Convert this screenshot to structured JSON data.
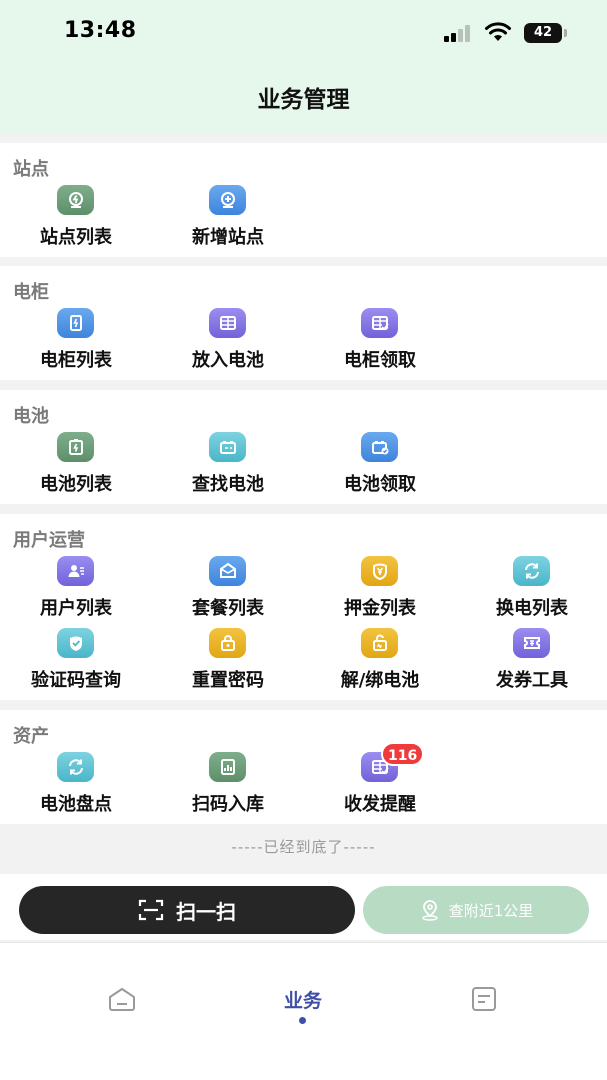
{
  "status_bar": {
    "time": "13:48",
    "battery": "42"
  },
  "header": {
    "title": "业务管理"
  },
  "sections": [
    {
      "title": "站点",
      "items": [
        {
          "label": "站点列表",
          "icon": "station-list-icon",
          "color": "#6b9c78"
        },
        {
          "label": "新增站点",
          "icon": "add-station-icon",
          "color": "#4a8fe3"
        }
      ]
    },
    {
      "title": "电柜",
      "items": [
        {
          "label": "电柜列表",
          "icon": "cabinet-list-icon",
          "color": "#4a8fe3"
        },
        {
          "label": "放入电池",
          "icon": "put-battery-icon",
          "color": "#7a6ae0"
        },
        {
          "label": "电柜领取",
          "icon": "cabinet-claim-icon",
          "color": "#7a6ae0"
        }
      ]
    },
    {
      "title": "电池",
      "items": [
        {
          "label": "电池列表",
          "icon": "battery-list-icon",
          "color": "#6b9c78"
        },
        {
          "label": "查找电池",
          "icon": "find-battery-icon",
          "color": "#49b6c9"
        },
        {
          "label": "电池领取",
          "icon": "battery-claim-icon",
          "color": "#4a8fe3"
        }
      ]
    },
    {
      "title": "用户运营",
      "items": [
        {
          "label": "用户列表",
          "icon": "user-list-icon",
          "color": "#7a6ae0"
        },
        {
          "label": "套餐列表",
          "icon": "package-list-icon",
          "color": "#4a8fe3"
        },
        {
          "label": "押金列表",
          "icon": "deposit-list-icon",
          "color": "#e2a614"
        },
        {
          "label": "换电列表",
          "icon": "swap-list-icon",
          "color": "#49b6c9"
        },
        {
          "label": "验证码查询",
          "icon": "verify-code-icon",
          "color": "#49b6c9"
        },
        {
          "label": "重置密码",
          "icon": "reset-password-icon",
          "color": "#e2a614"
        },
        {
          "label": "解/绑电池",
          "icon": "bind-battery-icon",
          "color": "#e2a614"
        },
        {
          "label": "发券工具",
          "icon": "coupon-tool-icon",
          "color": "#7a6ae0"
        }
      ]
    },
    {
      "title": "资产",
      "items": [
        {
          "label": "电池盘点",
          "icon": "battery-inventory-icon",
          "color": "#49b6c9"
        },
        {
          "label": "扫码入库",
          "icon": "scan-stock-in-icon",
          "color": "#6b9c78"
        },
        {
          "label": "收发提醒",
          "icon": "delivery-reminder-icon",
          "color": "#7a6ae0",
          "badge": "116"
        }
      ]
    }
  ],
  "bottom_note": "-----已经到底了-----",
  "actions": {
    "scan": "扫一扫",
    "nearby": "查附近1公里"
  },
  "tabbar": {
    "active_label": "业务"
  }
}
